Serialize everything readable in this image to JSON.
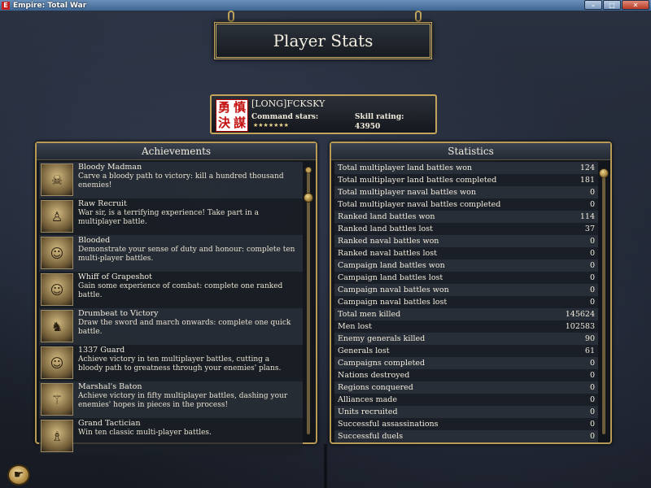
{
  "window": {
    "title": "Empire: Total War",
    "icon_glyph": "E",
    "buttons": {
      "minimize": "–",
      "maximize": "□",
      "close": "✕"
    }
  },
  "header": {
    "title": "Player Stats"
  },
  "player": {
    "name": "[LONG]FCKSKY",
    "badge_chars": [
      "勇",
      "慎",
      "決",
      "謀"
    ],
    "command_stars_label": "Command stars:",
    "command_stars": "★★★★★★★",
    "skill_rating_label": "Skill rating:",
    "skill_rating": "43950"
  },
  "achievements": {
    "title": "Achievements",
    "items": [
      {
        "title": "Bloody Madman",
        "description": "Carve a bloody path to victory: kill a hundred thousand enemies!",
        "icon": "skull-icon",
        "glyph": "☠"
      },
      {
        "title": "Raw Recruit",
        "description": "War sir, is a terrifying experience! Take part in a multiplayer battle.",
        "icon": "soldier-icon",
        "glyph": "♙"
      },
      {
        "title": "Blooded",
        "description": "Demonstrate your sense of duty and honour: complete ten multi-player battles.",
        "icon": "officer-portrait-icon",
        "glyph": "☺"
      },
      {
        "title": "Whiff of Grapeshot",
        "description": "Gain some experience of combat: complete one ranked battle.",
        "icon": "officer-portrait-icon",
        "glyph": "☺"
      },
      {
        "title": "Drumbeat to Victory",
        "description": "Draw the sword and march onwards: complete one quick battle.",
        "icon": "boots-icon",
        "glyph": "♞"
      },
      {
        "title": "1337 Guard",
        "description": "Achieve victory in ten multiplayer battles, cutting a bloody path to greatness through your enemies' plans.",
        "icon": "general-portrait-icon",
        "glyph": "☺"
      },
      {
        "title": "Marshal's Baton",
        "description": "Achieve victory in fifty multiplayer battles, dashing your enemies' hopes in pieces in the process!",
        "icon": "baton-icon",
        "glyph": "⚚"
      },
      {
        "title": "Grand Tactician",
        "description": "Win ten classic multi-player battles.",
        "icon": "figure-icon",
        "glyph": "♗"
      }
    ]
  },
  "statistics": {
    "title": "Statistics",
    "rows": [
      {
        "label": "Total multiplayer land battles won",
        "value": "124"
      },
      {
        "label": "Total multiplayer land battles completed",
        "value": "181"
      },
      {
        "label": "Total multiplayer naval battles won",
        "value": "0"
      },
      {
        "label": "Total multiplayer naval battles completed",
        "value": "0"
      },
      {
        "label": "Ranked land battles won",
        "value": "114"
      },
      {
        "label": "Ranked land battles lost",
        "value": "37"
      },
      {
        "label": "Ranked naval battles won",
        "value": "0"
      },
      {
        "label": "Ranked naval battles lost",
        "value": "0"
      },
      {
        "label": "Campaign land battles won",
        "value": "0"
      },
      {
        "label": "Campaign land battles lost",
        "value": "0"
      },
      {
        "label": "Campaign naval battles won",
        "value": "0"
      },
      {
        "label": "Campaign naval battles lost",
        "value": "0"
      },
      {
        "label": "Total men killed",
        "value": "145624"
      },
      {
        "label": "Men lost",
        "value": "102583"
      },
      {
        "label": "Enemy generals killed",
        "value": "90"
      },
      {
        "label": "Generals lost",
        "value": "61"
      },
      {
        "label": "Campaigns completed",
        "value": "0"
      },
      {
        "label": "Nations destroyed",
        "value": "0"
      },
      {
        "label": "Regions conquered",
        "value": "0"
      },
      {
        "label": "Alliances made",
        "value": "0"
      },
      {
        "label": "Units recruited",
        "value": "0"
      },
      {
        "label": "Successful assassinations",
        "value": "0"
      },
      {
        "label": "Successful duels",
        "value": "0"
      }
    ]
  },
  "back_button": {
    "icon": "pointing-hand-icon",
    "glyph": "☛"
  },
  "colors": {
    "gold_border": "#c4a45b",
    "panel_bg": "#101318",
    "text": "#f2ecdc"
  }
}
